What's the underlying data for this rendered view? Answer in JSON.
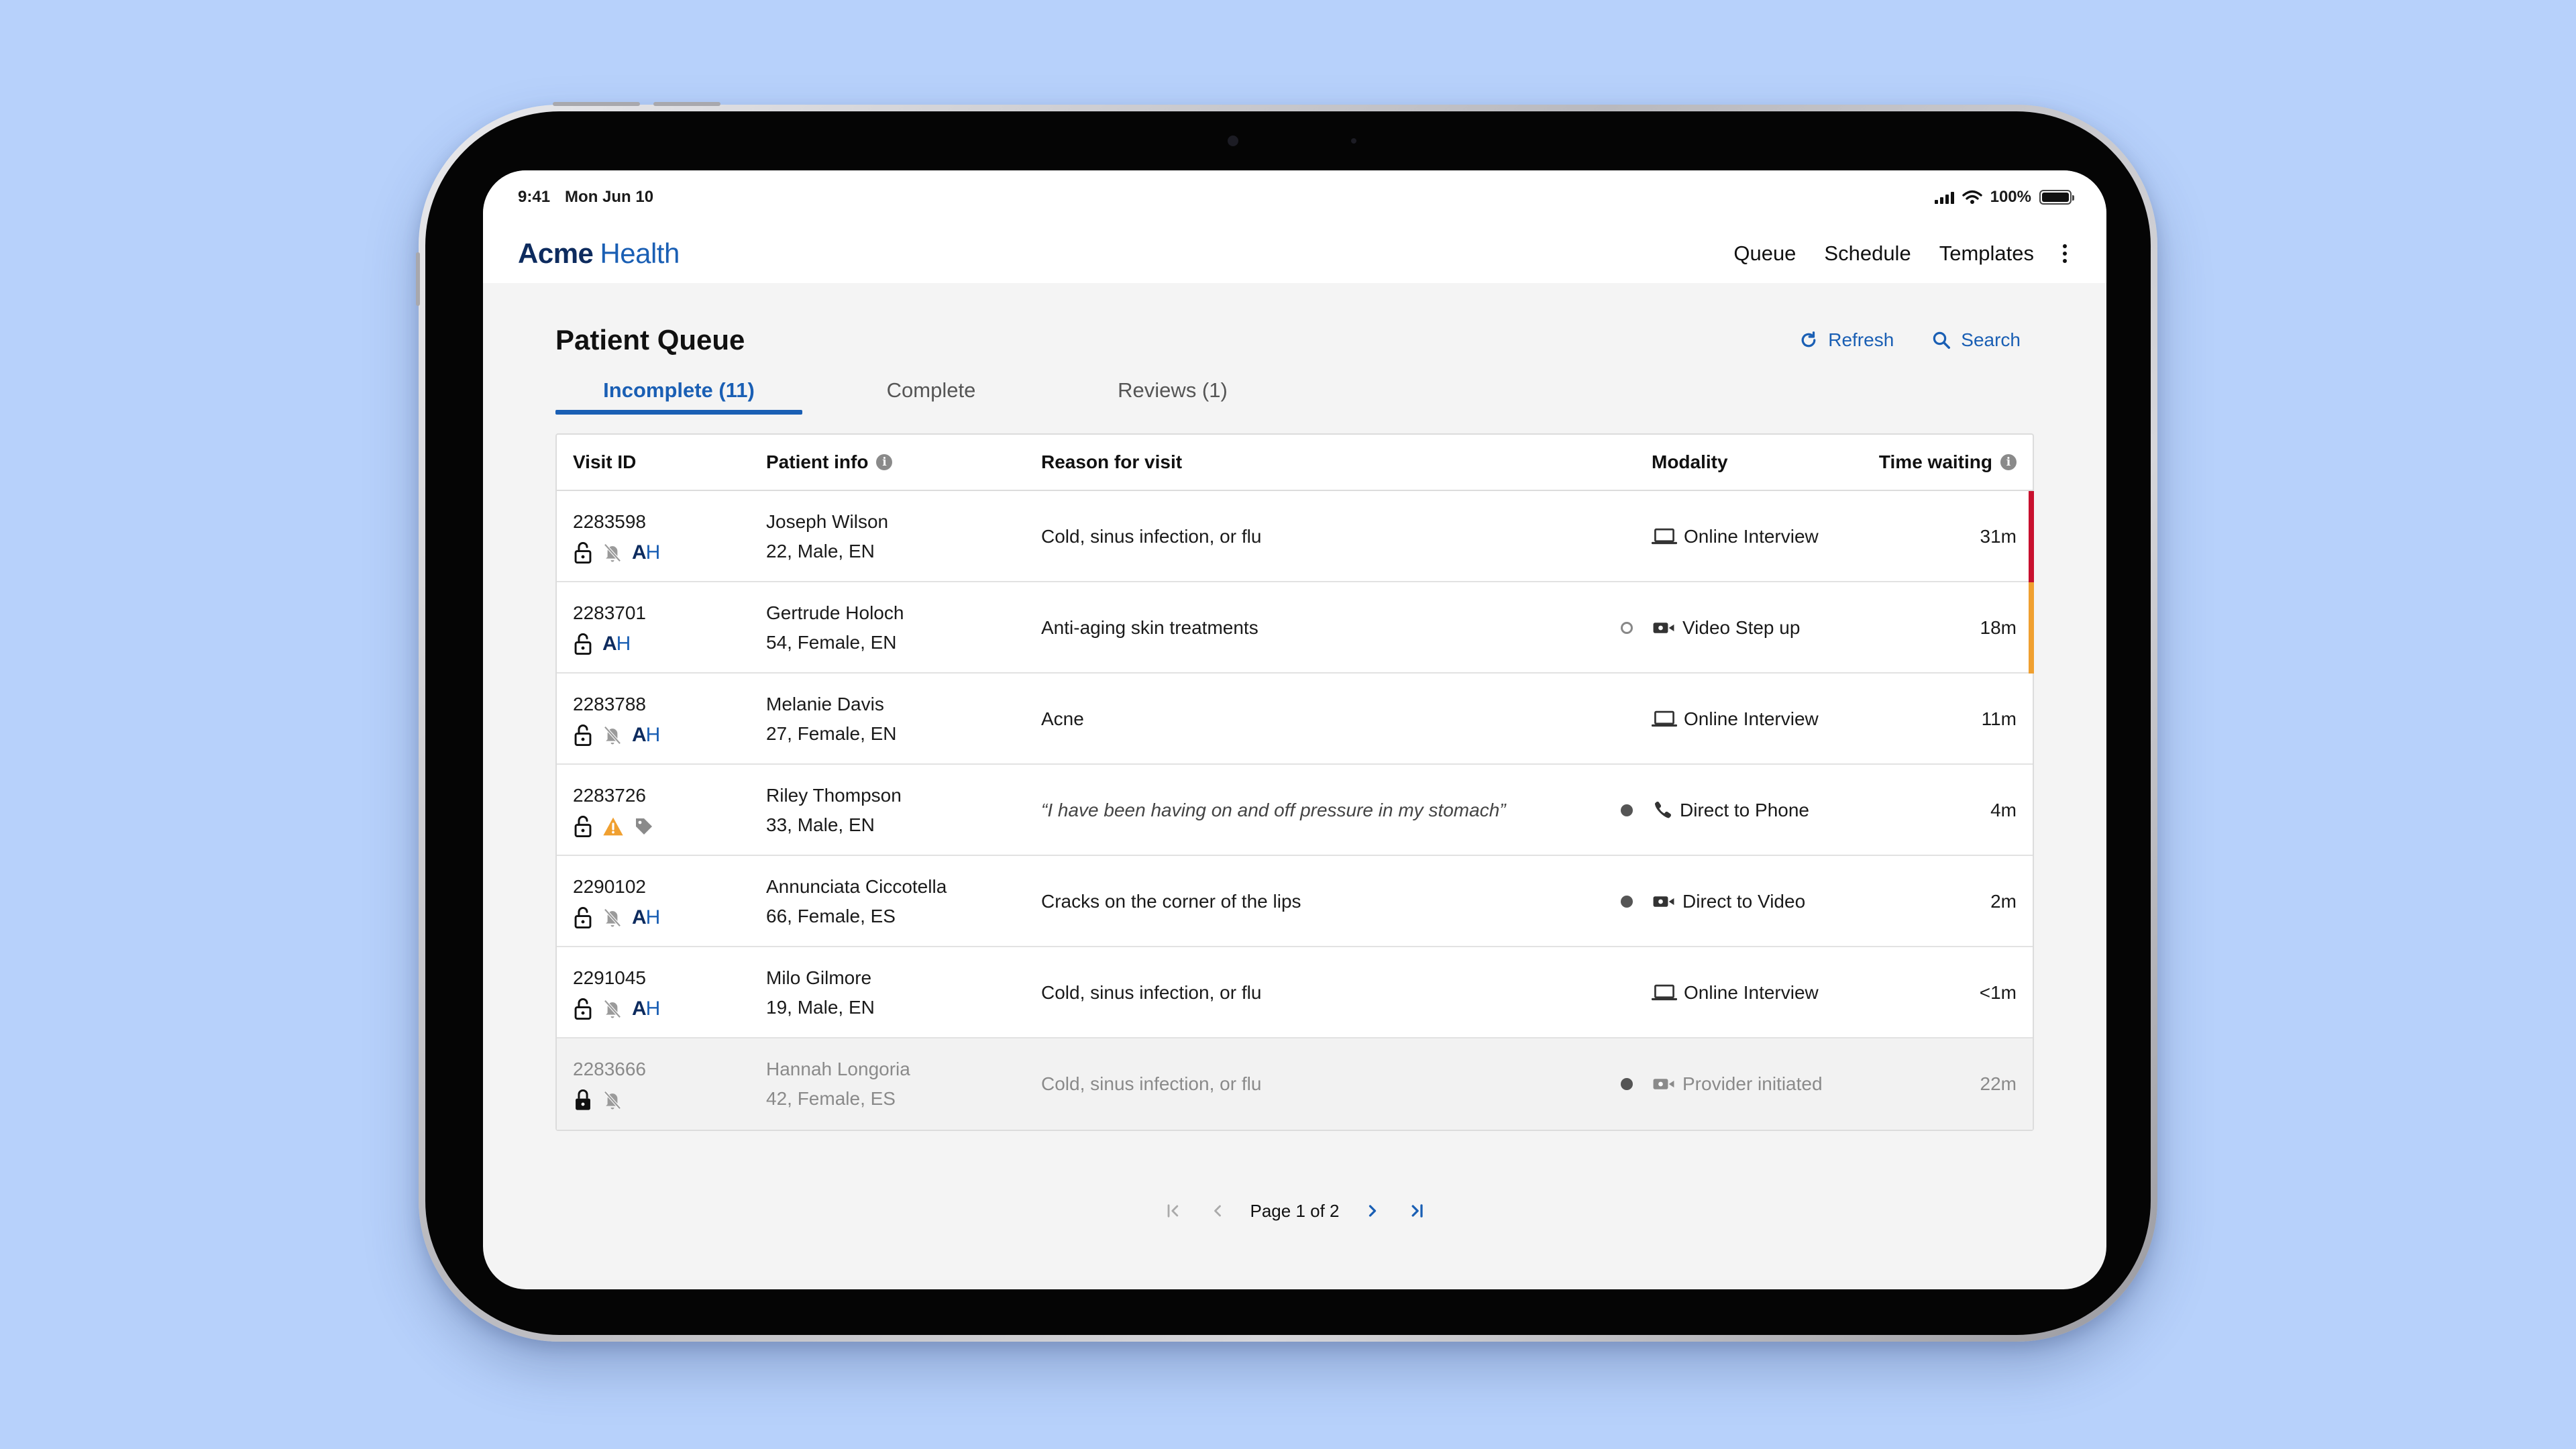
{
  "status_bar": {
    "time": "9:41",
    "date": "Mon Jun 10",
    "battery": "100%"
  },
  "brand": {
    "part1": "Acme",
    "part2": "Health"
  },
  "nav": {
    "queue": "Queue",
    "schedule": "Schedule",
    "templates": "Templates"
  },
  "page": {
    "title": "Patient Queue",
    "refresh": "Refresh",
    "search": "Search"
  },
  "tabs": [
    {
      "label": "Incomplete (11)",
      "active": true
    },
    {
      "label": "Complete",
      "active": false
    },
    {
      "label": "Reviews (1)",
      "active": false
    }
  ],
  "table": {
    "headers": {
      "visit_id": "Visit ID",
      "patient_info": "Patient info",
      "reason": "Reason for visit",
      "modality": "Modality",
      "time_waiting": "Time waiting"
    },
    "rows": [
      {
        "visit_id": "2283598",
        "name": "Joseph Wilson",
        "demo": "22, Male, EN",
        "reason": "Cold, sinus infection, or flu",
        "quote": false,
        "dot": "none",
        "modality": "Online Interview",
        "modality_icon": "laptop-icon",
        "waiting": "31m",
        "flag_color": "#c8102e",
        "icons": [
          "lock-open",
          "bell-off",
          "ah"
        ],
        "disabled": false
      },
      {
        "visit_id": "2283701",
        "name": "Gertrude Holoch",
        "demo": "54, Female, EN",
        "reason": "Anti-aging skin treatments",
        "quote": false,
        "dot": "hollow",
        "modality": "Video Step up",
        "modality_icon": "video-icon",
        "waiting": "18m",
        "flag_color": "#f0a030",
        "icons": [
          "lock-open",
          "ah"
        ],
        "disabled": false
      },
      {
        "visit_id": "2283788",
        "name": "Melanie Davis",
        "demo": "27, Female, EN",
        "reason": "Acne",
        "quote": false,
        "dot": "none",
        "modality": "Online Interview",
        "modality_icon": "laptop-icon",
        "waiting": "11m",
        "flag_color": "",
        "icons": [
          "lock-open",
          "bell-off",
          "ah"
        ],
        "disabled": false
      },
      {
        "visit_id": "2283726",
        "name": "Riley Thompson",
        "demo": "33, Male, EN",
        "reason": "“I have been having on and off pressure in my stomach”",
        "quote": true,
        "dot": "filled",
        "modality": "Direct to Phone",
        "modality_icon": "phone-icon",
        "waiting": "4m",
        "flag_color": "",
        "icons": [
          "lock-open",
          "warning",
          "tag"
        ],
        "disabled": false
      },
      {
        "visit_id": "2290102",
        "name": "Annunciata Ciccotella",
        "demo": "66, Female, ES",
        "reason": "Cracks on the corner of the lips",
        "quote": false,
        "dot": "filled",
        "modality": "Direct to Video",
        "modality_icon": "video-icon",
        "waiting": "2m",
        "flag_color": "",
        "icons": [
          "lock-open",
          "bell-off",
          "ah"
        ],
        "disabled": false
      },
      {
        "visit_id": "2291045",
        "name": "Milo Gilmore",
        "demo": "19, Male, EN",
        "reason": "Cold, sinus infection, or flu",
        "quote": false,
        "dot": "none",
        "modality": "Online Interview",
        "modality_icon": "laptop-icon",
        "waiting": "<1m",
        "flag_color": "",
        "icons": [
          "lock-open",
          "bell-off",
          "ah"
        ],
        "disabled": false
      },
      {
        "visit_id": "2283666",
        "name": "Hannah Longoria",
        "demo": "42, Female, ES",
        "reason": "Cold, sinus infection, or flu",
        "quote": false,
        "dot": "filled",
        "modality": "Provider initiated",
        "modality_icon": "video-icon",
        "waiting": "22m",
        "flag_color": "",
        "icons": [
          "lock-closed",
          "bell-off"
        ],
        "disabled": true
      }
    ]
  },
  "pagination": {
    "label": "Page 1 of 2"
  },
  "colors": {
    "brand_dark": "#0d2b5e",
    "accent": "#1a5fb4",
    "urgent": "#c8102e",
    "warning": "#f0a030",
    "background": "#b7d1fb"
  }
}
